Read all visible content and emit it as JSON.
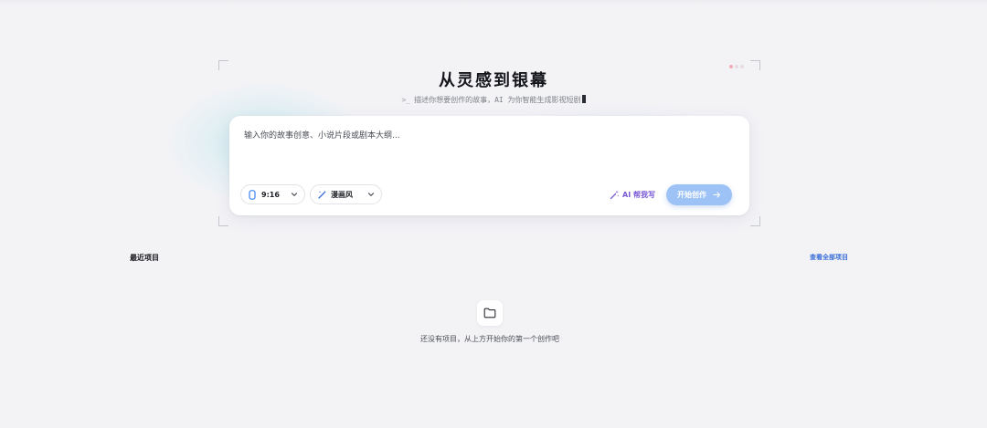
{
  "hero": {
    "title": "从灵感到银幕",
    "prompt_symbol": ">_",
    "subtitle": "描述你想要创作的故事，AI 为你智能生成影视短剧"
  },
  "composer": {
    "placeholder": "输入你的故事创意、小说片段或剧本大纲...",
    "value": "",
    "aspect_ratio": {
      "label": "9:16",
      "icon": "phone-portrait-icon"
    },
    "style": {
      "label": "漫画风",
      "icon": "magic-wand-icon"
    },
    "ai_write_label": "AI 帮我写",
    "start_label": "开始创作",
    "start_color": "#9cc2f6",
    "accent_purple": "#7b5ad6"
  },
  "recent": {
    "title": "最近项目",
    "view_all_label": "查看全部项目",
    "view_all_color": "#3b6fd8",
    "empty_icon": "folder-icon",
    "empty_text": "还没有项目，从上方开始你的第一个创作吧"
  }
}
